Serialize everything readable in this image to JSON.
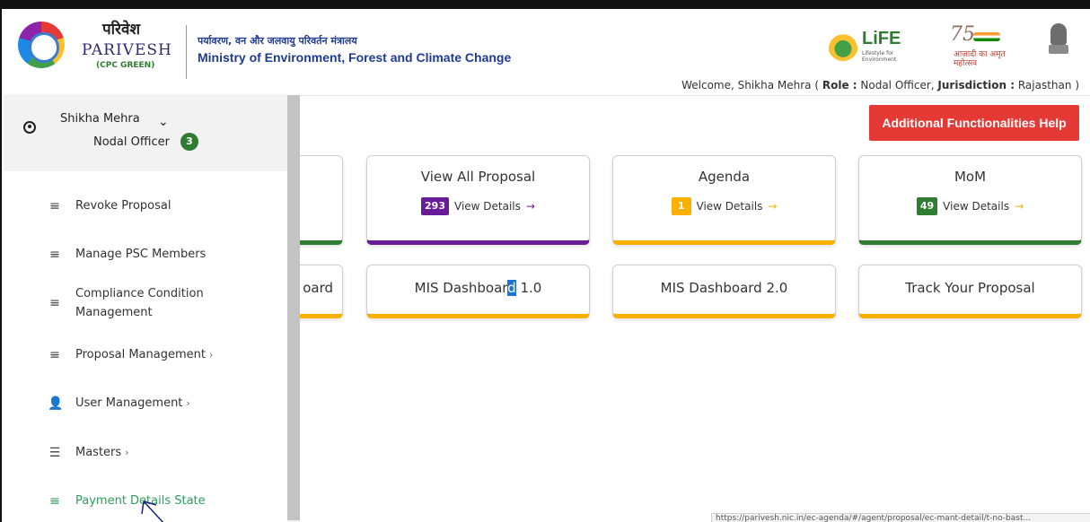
{
  "header": {
    "brand_hindi": "परिवेश",
    "brand_name": "PARIVESH",
    "brand_sub": "(CPC GREEN)",
    "ministry_hindi": "पर्यावरण, वन और जलवायु परिवर्तन मंत्रालय",
    "ministry_en": "Ministry of Environment, Forest and Climate Change",
    "life_text": "LiFE",
    "life_sub": "Lifestyle for Environment",
    "azadi_num": "75",
    "azadi_text": "आज़ादी का अमृत महोत्सव",
    "welcome_prefix": "Welcome, Shikha Mehra ( ",
    "role_label": "Role :",
    "role_value": " Nodal Officer,  ",
    "jurisdiction_label": "Jurisdiction :",
    "jurisdiction_value": " Rajasthan )"
  },
  "sidebar": {
    "user_name": "Shikha Mehra",
    "user_role": "Nodal Officer",
    "role_count": "3",
    "items": [
      {
        "label": "Revoke Proposal",
        "icon": "menu-icon",
        "chevron": false
      },
      {
        "label": "Manage PSC Members",
        "icon": "menu-icon",
        "chevron": false
      },
      {
        "label": "Compliance Condition",
        "label2": "Management",
        "icon": "menu-icon",
        "chevron": false
      },
      {
        "label": "Proposal Management",
        "icon": "menu-icon",
        "chevron": true
      },
      {
        "label": "User Management",
        "icon": "user-list-icon",
        "chevron": true
      },
      {
        "label": "Masters",
        "icon": "list-icon",
        "chevron": true
      },
      {
        "label": "Payment Details State",
        "icon": "menu-icon",
        "chevron": false,
        "active": true
      }
    ]
  },
  "main": {
    "help_button": "Additional Functionalities Help",
    "cards": [
      {
        "title": "View All Proposal",
        "count": "293",
        "link": "View Details",
        "arrow": "→",
        "color": "#6a1b9a"
      },
      {
        "title": "Agenda",
        "count": "1",
        "link": "View Details",
        "arrow": "→",
        "color": "#f9b000"
      },
      {
        "title": "MoM",
        "count": "49",
        "link": "View Details",
        "arrow": "→",
        "color": "#2e7d32"
      }
    ],
    "partial_card_text": "oard",
    "dashboards": [
      {
        "title_pre": "MIS Dashboar",
        "title_sel": "d",
        "title_post": " 1.0"
      },
      {
        "title": "MIS Dashboard 2.0"
      },
      {
        "title": "Track Your Proposal"
      }
    ]
  },
  "statusbar": {
    "url": "https://parivesh.nic.in/ec-agenda/#/agent/proposal/ec-mant-detail/t-no-bast..."
  },
  "colors": {
    "accent_red": "#e53935",
    "purple": "#6a1b9a",
    "yellow": "#f9b000",
    "green": "#2e7d32",
    "active_nav": "#2e9e5b"
  }
}
